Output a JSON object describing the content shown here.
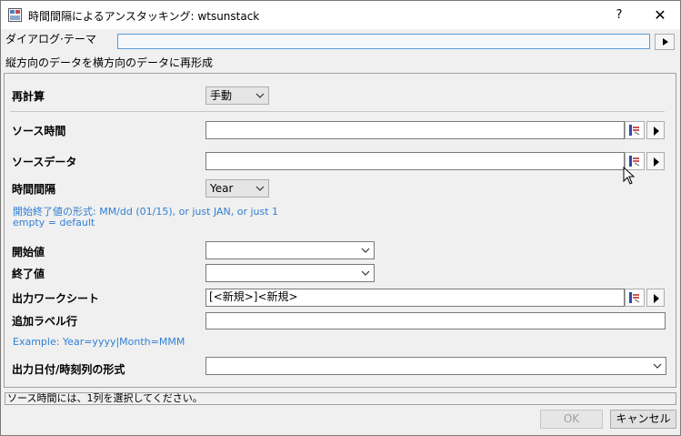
{
  "window": {
    "title": "時間間隔によるアンスタッキング: wtsunstack",
    "help_label": "?",
    "close_label": "✕",
    "icons": {
      "app": "app-icon",
      "close": "close-icon",
      "help": "help-icon"
    }
  },
  "theme": {
    "label": "ダイアログ·テーマ",
    "value": "",
    "arrow": "▸"
  },
  "description": "縦方向のデータを横方向のデータに再形成",
  "recalc": {
    "label": "再計算",
    "value": "手動"
  },
  "source_time": {
    "label": "ソース時間",
    "value": ""
  },
  "source_data": {
    "label": "ソースデータ",
    "value": ""
  },
  "interval": {
    "label": "時間間隔",
    "value": "Year"
  },
  "notes": {
    "end_format": "開始終了値の形式: MM/dd (01/15), or just JAN, or just 1",
    "empty_default": "empty = default",
    "example": "Example: Year=yyyy|Month=MMM"
  },
  "start_value": {
    "label": "開始値",
    "value": ""
  },
  "end_value": {
    "label": "終了値",
    "value": ""
  },
  "output_sheet": {
    "label": "出力ワークシート",
    "value": "[<新規>]<新規>"
  },
  "extra_label_row": {
    "label": "追加ラベル行",
    "value": ""
  },
  "output_date_format": {
    "label": "出力日付/時刻列の形式",
    "value": ""
  },
  "status": "ソース時間には、1列を選択してください。",
  "buttons": {
    "ok": "OK",
    "cancel": "キャンセル"
  },
  "colors": {
    "note_blue": "#2f7fd3",
    "focus_border": "#5b9bd5"
  }
}
